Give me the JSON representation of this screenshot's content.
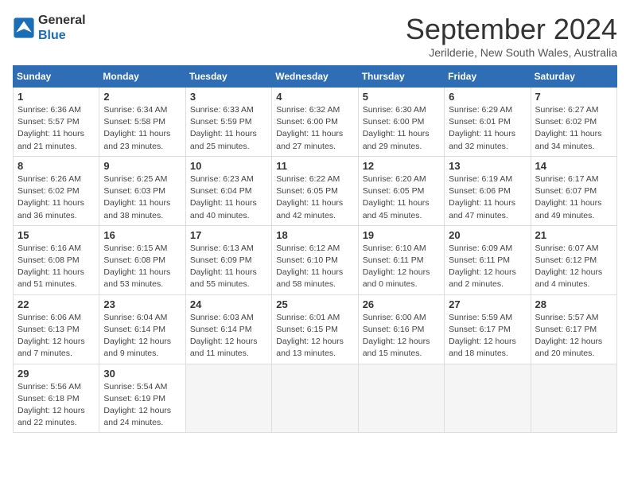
{
  "logo": {
    "line1": "General",
    "line2": "Blue"
  },
  "title": "September 2024",
  "subtitle": "Jerilderie, New South Wales, Australia",
  "days_of_week": [
    "Sunday",
    "Monday",
    "Tuesday",
    "Wednesday",
    "Thursday",
    "Friday",
    "Saturday"
  ],
  "weeks": [
    [
      {
        "day": "1",
        "sunrise": "6:36 AM",
        "sunset": "5:57 PM",
        "daylight": "11 hours and 21 minutes."
      },
      {
        "day": "2",
        "sunrise": "6:34 AM",
        "sunset": "5:58 PM",
        "daylight": "11 hours and 23 minutes."
      },
      {
        "day": "3",
        "sunrise": "6:33 AM",
        "sunset": "5:59 PM",
        "daylight": "11 hours and 25 minutes."
      },
      {
        "day": "4",
        "sunrise": "6:32 AM",
        "sunset": "6:00 PM",
        "daylight": "11 hours and 27 minutes."
      },
      {
        "day": "5",
        "sunrise": "6:30 AM",
        "sunset": "6:00 PM",
        "daylight": "11 hours and 29 minutes."
      },
      {
        "day": "6",
        "sunrise": "6:29 AM",
        "sunset": "6:01 PM",
        "daylight": "11 hours and 32 minutes."
      },
      {
        "day": "7",
        "sunrise": "6:27 AM",
        "sunset": "6:02 PM",
        "daylight": "11 hours and 34 minutes."
      }
    ],
    [
      {
        "day": "8",
        "sunrise": "6:26 AM",
        "sunset": "6:02 PM",
        "daylight": "11 hours and 36 minutes."
      },
      {
        "day": "9",
        "sunrise": "6:25 AM",
        "sunset": "6:03 PM",
        "daylight": "11 hours and 38 minutes."
      },
      {
        "day": "10",
        "sunrise": "6:23 AM",
        "sunset": "6:04 PM",
        "daylight": "11 hours and 40 minutes."
      },
      {
        "day": "11",
        "sunrise": "6:22 AM",
        "sunset": "6:05 PM",
        "daylight": "11 hours and 42 minutes."
      },
      {
        "day": "12",
        "sunrise": "6:20 AM",
        "sunset": "6:05 PM",
        "daylight": "11 hours and 45 minutes."
      },
      {
        "day": "13",
        "sunrise": "6:19 AM",
        "sunset": "6:06 PM",
        "daylight": "11 hours and 47 minutes."
      },
      {
        "day": "14",
        "sunrise": "6:17 AM",
        "sunset": "6:07 PM",
        "daylight": "11 hours and 49 minutes."
      }
    ],
    [
      {
        "day": "15",
        "sunrise": "6:16 AM",
        "sunset": "6:08 PM",
        "daylight": "11 hours and 51 minutes."
      },
      {
        "day": "16",
        "sunrise": "6:15 AM",
        "sunset": "6:08 PM",
        "daylight": "11 hours and 53 minutes."
      },
      {
        "day": "17",
        "sunrise": "6:13 AM",
        "sunset": "6:09 PM",
        "daylight": "11 hours and 55 minutes."
      },
      {
        "day": "18",
        "sunrise": "6:12 AM",
        "sunset": "6:10 PM",
        "daylight": "11 hours and 58 minutes."
      },
      {
        "day": "19",
        "sunrise": "6:10 AM",
        "sunset": "6:11 PM",
        "daylight": "12 hours and 0 minutes."
      },
      {
        "day": "20",
        "sunrise": "6:09 AM",
        "sunset": "6:11 PM",
        "daylight": "12 hours and 2 minutes."
      },
      {
        "day": "21",
        "sunrise": "6:07 AM",
        "sunset": "6:12 PM",
        "daylight": "12 hours and 4 minutes."
      }
    ],
    [
      {
        "day": "22",
        "sunrise": "6:06 AM",
        "sunset": "6:13 PM",
        "daylight": "12 hours and 7 minutes."
      },
      {
        "day": "23",
        "sunrise": "6:04 AM",
        "sunset": "6:14 PM",
        "daylight": "12 hours and 9 minutes."
      },
      {
        "day": "24",
        "sunrise": "6:03 AM",
        "sunset": "6:14 PM",
        "daylight": "12 hours and 11 minutes."
      },
      {
        "day": "25",
        "sunrise": "6:01 AM",
        "sunset": "6:15 PM",
        "daylight": "12 hours and 13 minutes."
      },
      {
        "day": "26",
        "sunrise": "6:00 AM",
        "sunset": "6:16 PM",
        "daylight": "12 hours and 15 minutes."
      },
      {
        "day": "27",
        "sunrise": "5:59 AM",
        "sunset": "6:17 PM",
        "daylight": "12 hours and 18 minutes."
      },
      {
        "day": "28",
        "sunrise": "5:57 AM",
        "sunset": "6:17 PM",
        "daylight": "12 hours and 20 minutes."
      }
    ],
    [
      {
        "day": "29",
        "sunrise": "5:56 AM",
        "sunset": "6:18 PM",
        "daylight": "12 hours and 22 minutes."
      },
      {
        "day": "30",
        "sunrise": "5:54 AM",
        "sunset": "6:19 PM",
        "daylight": "12 hours and 24 minutes."
      },
      null,
      null,
      null,
      null,
      null
    ]
  ]
}
